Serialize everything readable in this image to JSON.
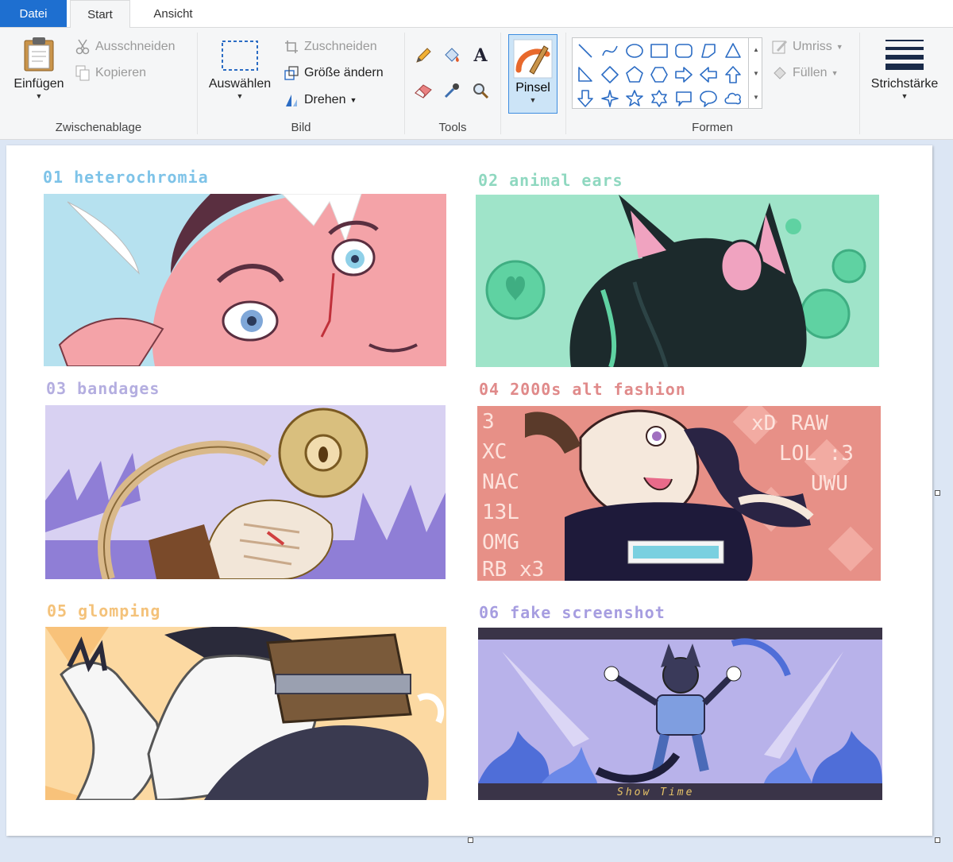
{
  "tabs": {
    "file": "Datei",
    "start": "Start",
    "view": "Ansicht"
  },
  "ribbon": {
    "clipboard": {
      "label": "Zwischenablage",
      "paste": "Einfügen",
      "cut": "Ausschneiden",
      "copy": "Kopieren"
    },
    "image": {
      "label": "Bild",
      "select": "Auswählen",
      "crop": "Zuschneiden",
      "resize": "Größe ändern",
      "rotate": "Drehen"
    },
    "tools": {
      "label": "Tools"
    },
    "brush": {
      "label": "Pinsel"
    },
    "shapes": {
      "label": "Formen",
      "outline": "Umriss",
      "fill": "Füllen"
    },
    "size": {
      "label": "Strichstärke"
    }
  },
  "canvas": {
    "panels": [
      {
        "title": "01 heterochromia",
        "color": "#7ec3e8"
      },
      {
        "title": "02 animal ears",
        "color": "#8fd8c0"
      },
      {
        "title": "03 bandages",
        "color": "#b4aee0"
      },
      {
        "title": "04 2000s alt fashion",
        "color": "#e08a8a"
      },
      {
        "title": "05 glomping",
        "color": "#f4c27a"
      },
      {
        "title": "06 fake screenshot",
        "color": "#a69de0"
      }
    ],
    "caption_06": "Show Time",
    "doodle_text_04": [
      "3",
      "xD",
      "RAW",
      "LOL :3",
      "UWU",
      "OMG",
      "RB x3",
      "XC",
      "NAC",
      "13L"
    ]
  }
}
